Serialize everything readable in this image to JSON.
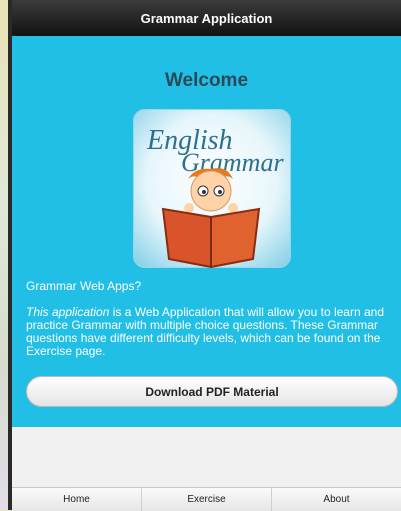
{
  "header": {
    "title": "Grammar Application"
  },
  "main": {
    "welcome": "Welcome",
    "logo": {
      "line1": "English",
      "line2": "Grammar",
      "icon": "boy-reading-book-icon"
    },
    "intro": "Grammar Web Apps?",
    "description_em": "This application",
    "description_rest": " is a Web Application that will allow you to learn and practice Grammar with multiple choice questions. These Grammar questions have different difficulty levels, which can be found on the Exercise page.",
    "download_button": "Download PDF Material"
  },
  "footer": {
    "tabs": [
      "Home",
      "Exercise",
      "About"
    ]
  },
  "colors": {
    "accent": "#21bfe6",
    "header": "#1a1a1a",
    "background": "#f1f1f1"
  }
}
